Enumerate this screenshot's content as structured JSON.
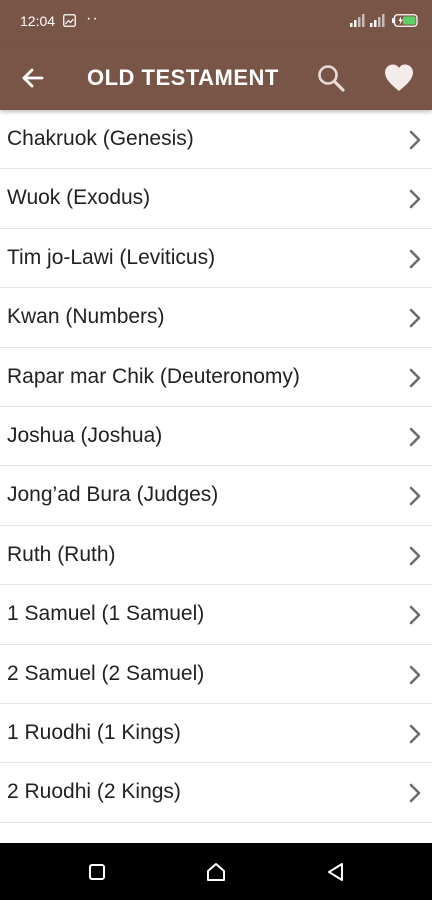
{
  "status_bar": {
    "time": "12:04",
    "dots": "··",
    "icons": [
      "image-icon",
      "signal-icon",
      "signal-icon",
      "battery-icon"
    ]
  },
  "app_bar": {
    "title": "OLD TESTAMENT",
    "background": "#795548",
    "icons": [
      "back-arrow-icon",
      "search-icon",
      "heart-icon"
    ]
  },
  "books": [
    {
      "label": "Chakruok (Genesis)"
    },
    {
      "label": "Wuok (Exodus)"
    },
    {
      "label": "Tim jo-Lawi (Leviticus)"
    },
    {
      "label": "Kwan (Numbers)"
    },
    {
      "label": "Rapar mar Chik (Deuteronomy)"
    },
    {
      "label": "Joshua (Joshua)"
    },
    {
      "label": "Jong’ad Bura (Judges)"
    },
    {
      "label": "Ruth (Ruth)"
    },
    {
      "label": "1 Samuel (1 Samuel)"
    },
    {
      "label": "2 Samuel (2 Samuel)"
    },
    {
      "label": "1 Ruodhi (1 Kings)"
    },
    {
      "label": "2 Ruodhi (2 Kings)"
    }
  ],
  "nav_bar": {
    "icons": [
      "recent-apps-icon",
      "home-icon",
      "back-icon"
    ]
  }
}
